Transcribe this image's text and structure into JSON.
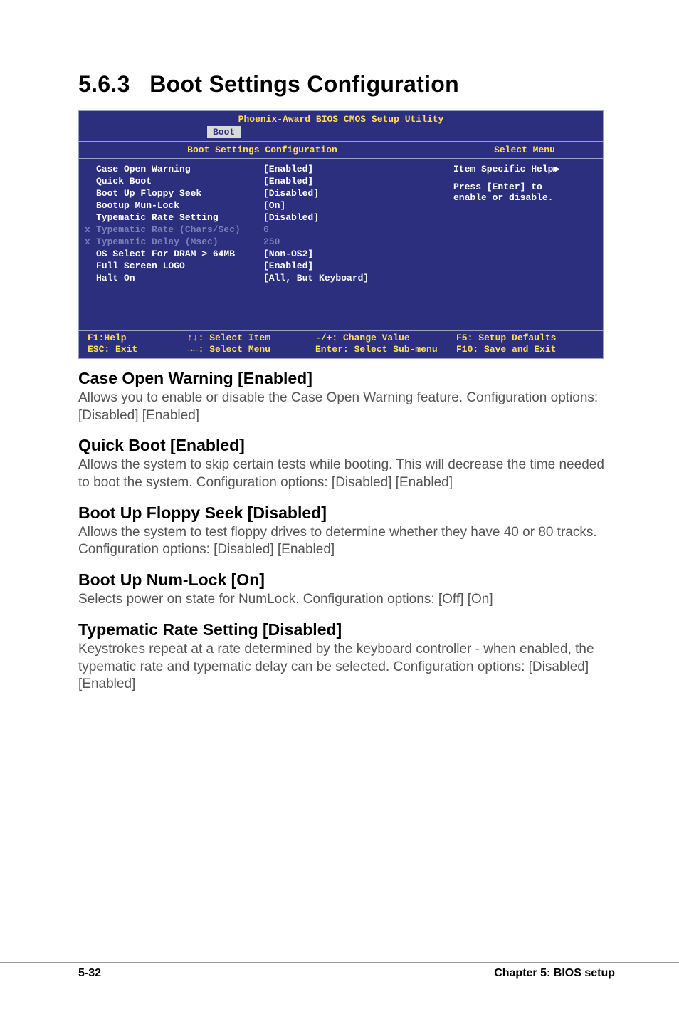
{
  "section": {
    "number": "5.6.3",
    "title": "Boot Settings Configuration"
  },
  "bios": {
    "title": "Phoenix-Award BIOS CMOS Setup Utility",
    "tab": "Boot",
    "leftHeader": "Boot Settings Configuration",
    "rightHeader": "Select Menu",
    "rows": [
      {
        "label": "Case Open Warning",
        "value": "[Enabled]",
        "dim": false
      },
      {
        "label": "Quick Boot",
        "value": "[Enabled]",
        "dim": false
      },
      {
        "label": "Boot Up Floppy Seek",
        "value": "[Disabled]",
        "dim": false
      },
      {
        "label": "Bootup Mun-Lock",
        "value": "[On]",
        "dim": false
      },
      {
        "label": "Typematic Rate Setting",
        "value": "[Disabled]",
        "dim": false
      },
      {
        "label": "Typematic Rate (Chars/Sec)",
        "value": "6",
        "dim": true
      },
      {
        "label": "Typematic Delay (Msec)",
        "value": "250",
        "dim": true
      },
      {
        "label": "OS Select For DRAM > 64MB",
        "value": "[Non-OS2]",
        "dim": false
      },
      {
        "label": "Full Screen LOGO",
        "value": "[Enabled]",
        "dim": false
      },
      {
        "label": "Halt On",
        "value": "[All, But Keyboard]",
        "dim": false
      }
    ],
    "help": {
      "line1": "Item Specific Help",
      "line2": "Press [Enter] to",
      "line3": "enable or disable."
    },
    "footer": {
      "f1": "F1:Help",
      "esc": "ESC: Exit",
      "selItem": "↑↓: Select Item",
      "selMenu": "→←: Select Menu",
      "change": "-/+: Change Value",
      "enter": "Enter: Select Sub-menu",
      "f5": "F5: Setup Defaults",
      "f10": "F10: Save and Exit"
    }
  },
  "s1": {
    "title": "Case Open Warning [Enabled]",
    "body": "Allows you to enable or disable the Case Open Warning feature. Configuration options: [Disabled] [Enabled]"
  },
  "s2": {
    "title": "Quick Boot [Enabled]",
    "body": "Allows the system to skip certain tests while booting. This will decrease the time needed to boot the system. Configuration options: [Disabled] [Enabled]"
  },
  "s3": {
    "title": "Boot Up Floppy Seek [Disabled]",
    "body": "Allows the system to test floppy drives to determine whether they have 40 or 80 tracks. Configuration options: [Disabled] [Enabled]"
  },
  "s4": {
    "title": "Boot Up Num-Lock [On]",
    "body": "Selects power on state for NumLock. Configuration options: [Off] [On]"
  },
  "s5": {
    "title": "Typematic Rate Setting [Disabled]",
    "body": "Keystrokes repeat at a rate determined by the keyboard controller - when enabled, the typematic rate and typematic delay can be selected. Configuration options: [Disabled] [Enabled]"
  },
  "footer": {
    "page": "5-32",
    "chapter": "Chapter 5: BIOS setup"
  }
}
